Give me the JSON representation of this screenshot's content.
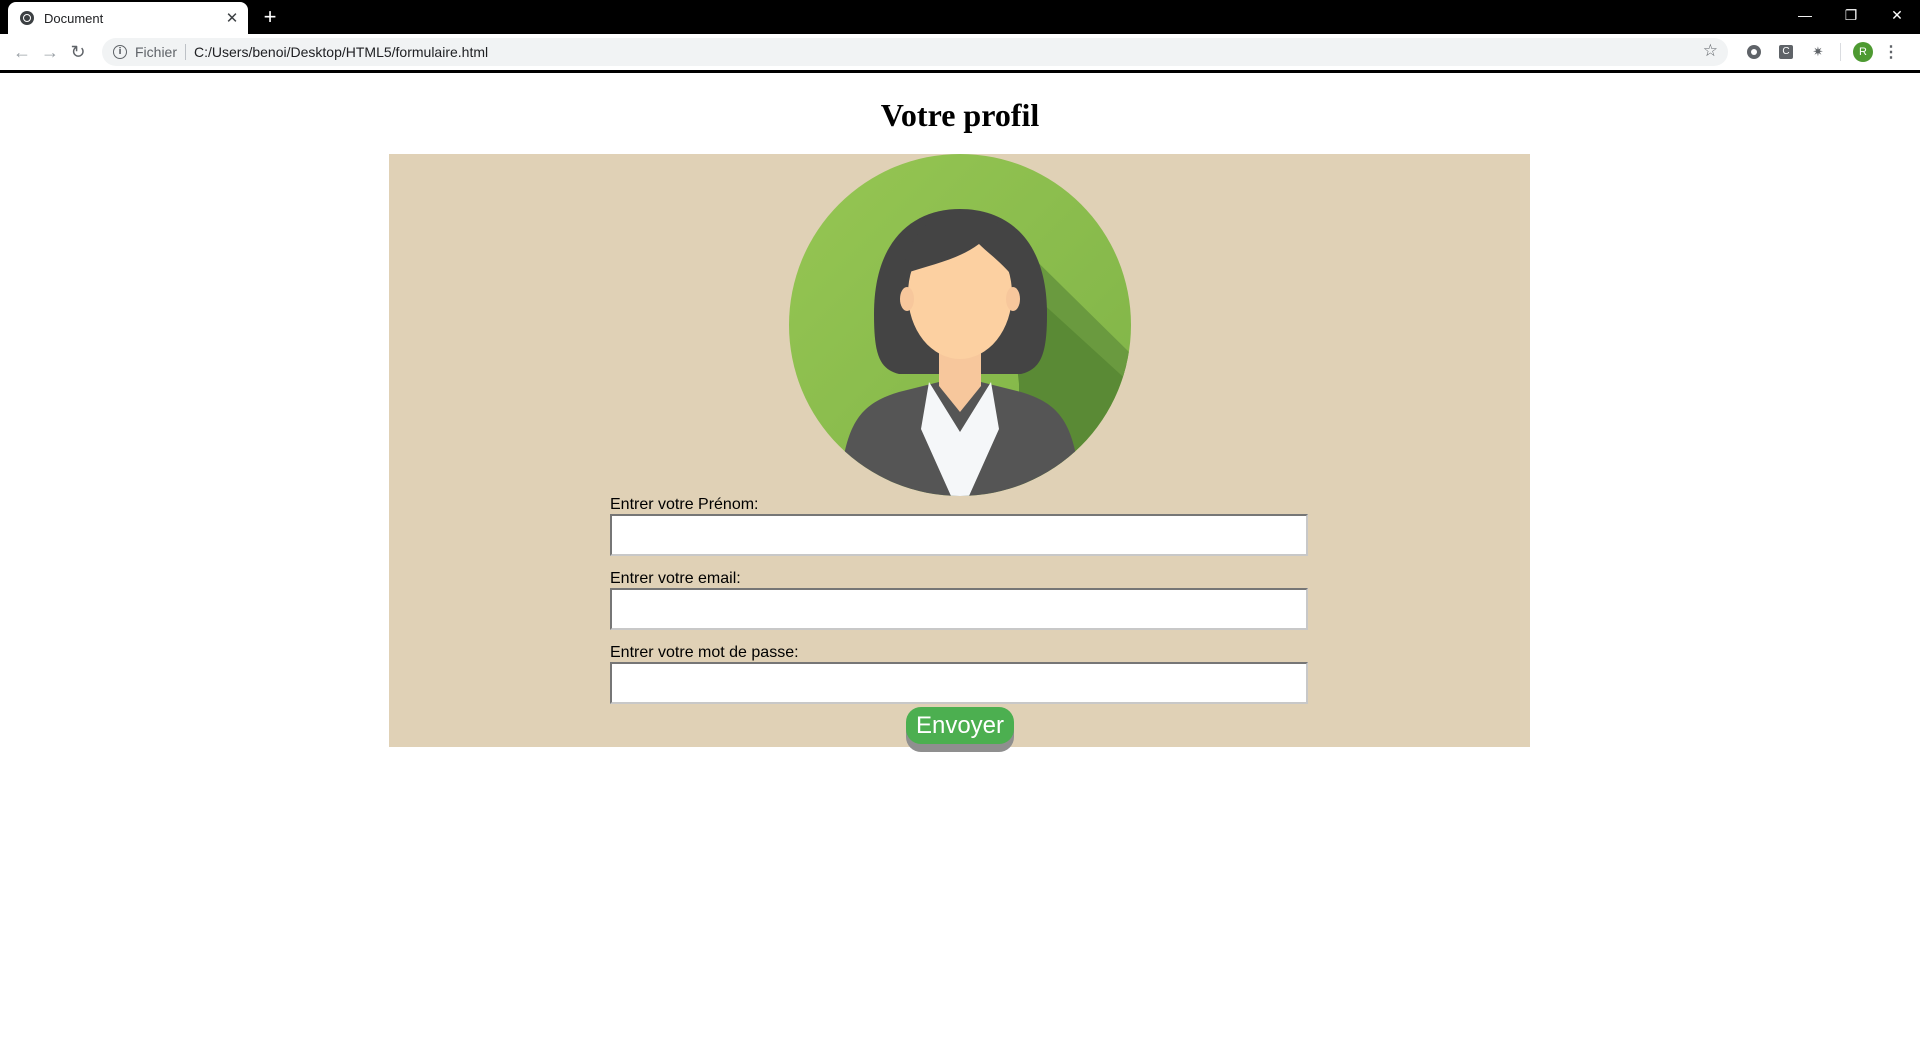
{
  "browser": {
    "tab_title": "Document",
    "close_glyph": "✕",
    "new_tab_glyph": "+",
    "window_controls": {
      "minimize": "—",
      "restore": "❐",
      "close": "✕"
    },
    "nav": {
      "back": "←",
      "forward": "→",
      "reload": "↻"
    },
    "omnibox": {
      "info_glyph": "i",
      "scheme_label": "Fichier",
      "url": "C:/Users/benoi/Desktop/HTML5/formulaire.html",
      "star_glyph": "☆"
    },
    "extensions": {
      "ext2_letter": "C",
      "ext3_glyph": "✷"
    },
    "profile_initial": "R",
    "menu_glyph": "⋮"
  },
  "page": {
    "title": "Votre profil",
    "form": {
      "firstname_label": "Entrer votre Prénom:",
      "email_label": "Entrer votre email:",
      "password_label": "Entrer votre mot de passe:",
      "firstname_value": "",
      "email_value": "",
      "password_value": "",
      "submit_label": "Envoyer"
    }
  },
  "colors": {
    "card_background": "#e0d1b6",
    "button_green": "#4caf50",
    "avatar_green": "#8bc34a"
  }
}
